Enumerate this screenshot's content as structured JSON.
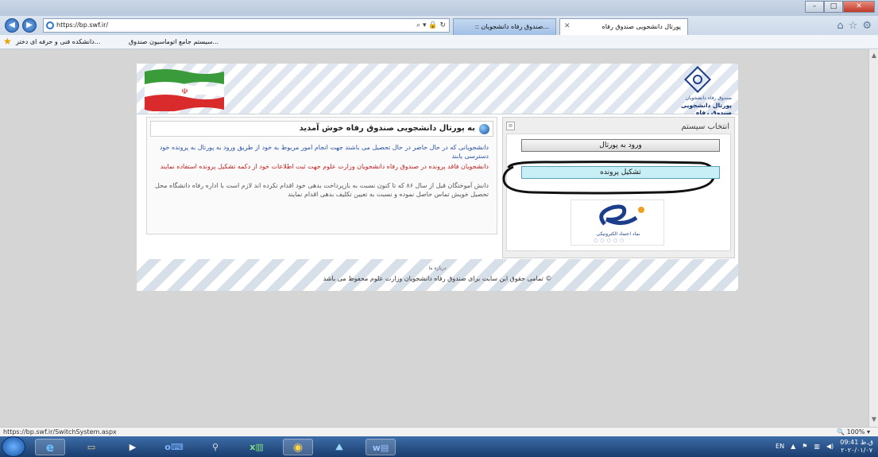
{
  "browser": {
    "url": "https://bp.swf.ir/",
    "search_icon": "search-icon",
    "tabs": [
      {
        "label": "پورتال دانشجویی صندوق رفاه",
        "active": true
      },
      {
        "label": "...صندوق رفاه دانشجویان ::"
      }
    ],
    "favorites": [
      {
        "label": "...سیستم جامع اتوماسیون صندوق"
      },
      {
        "label": "...دانشکده فنی و حرفه ای دختر"
      }
    ],
    "status_url": "https://bp.swf.ir/SwitchSystem.aspx",
    "zoom": "100%"
  },
  "header": {
    "logo_subtitle": "صندوق رفاه دانشجویان",
    "logo_title": "پورتال دانشجویی صندوق رفاه"
  },
  "system_panel": {
    "title": "انتخاب سیستم",
    "portal_button": "ورود به پورتال",
    "file_button": "تشکیل پرونده",
    "enamad_text": "نماد اعتماد الکترونیکی"
  },
  "welcome_panel": {
    "title": "به پورتال دانشجویی صندوق رفاه خوش آمدید",
    "para1": "دانشجویانی که در حال حاضر در حال تحصیل می باشند جهت انجام امور مربوط به خود از طریق ورود به پورتال به پرونده خود دسترسی یابند",
    "para2": "دانشجویان فاقد پرونده در صندوق رفاه دانشجویان وزارت علوم جهت ثبت اطلاعات خود از دکمه تشکیل پرونده استفاده نمایند",
    "para3": "دانش آموختگان قبل از سال ۸۶ که تا کنون نسبت به بازپرداخت بدهی خود اقدام نکرده اند لازم است با اداره رفاه دانشگاه محل تحصیل خویش تماس حاصل نموده و نسبت به تعیین تکلیف بدهی اقدام نمایند"
  },
  "footer": {
    "about": "درباره ما",
    "copyright": "© تمامی حقوق این سایت برای صندوق رفاه دانشجویان وزارت علوم محفوظ می باشد"
  },
  "taskbar": {
    "lang": "EN",
    "time": "09:41 ق.ظ",
    "date": "۲۰۲۰/۰۱/۰۷"
  }
}
